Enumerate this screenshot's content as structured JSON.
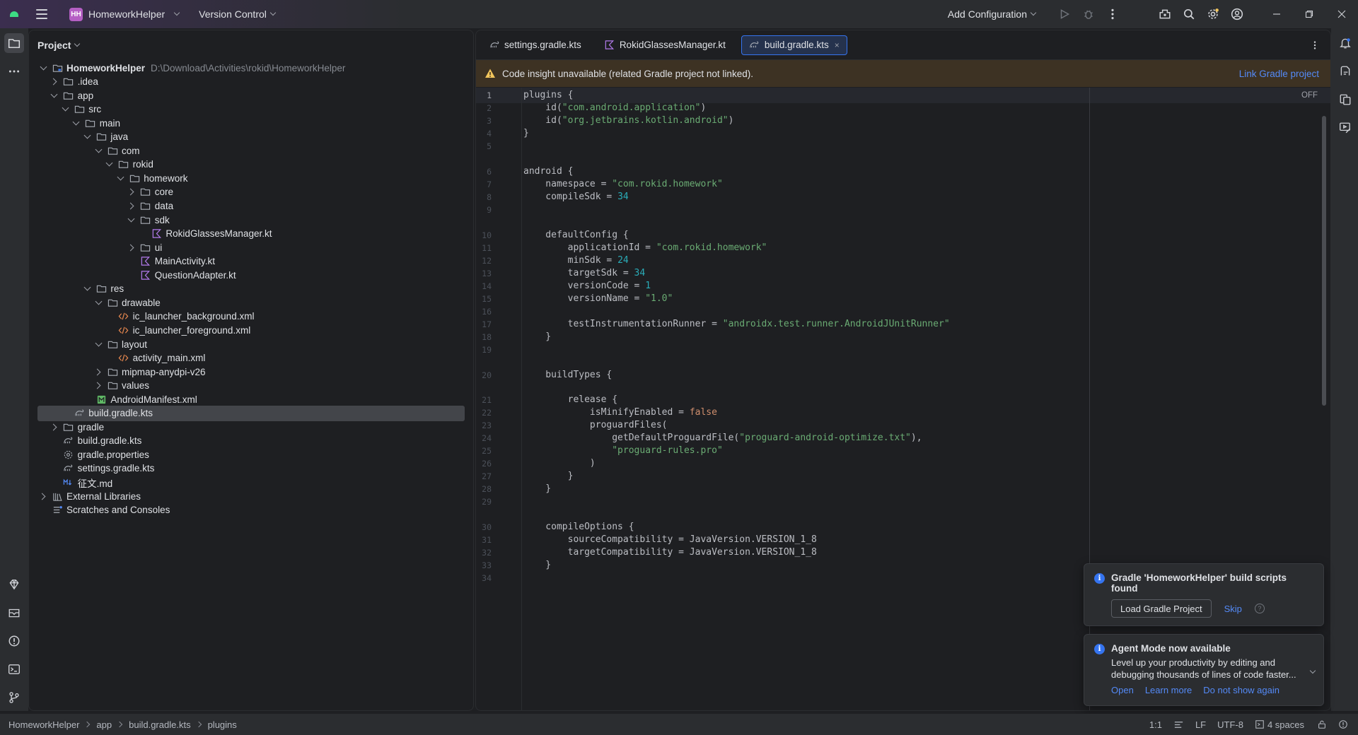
{
  "titlebar": {
    "project_initials": "HH",
    "project_name": "HomeworkHelper",
    "vcs_label": "Version Control",
    "config_label": "Add Configuration"
  },
  "project_panel": {
    "title": "Project",
    "tree": [
      {
        "label": "HomeworkHelper",
        "hint": "D:\\Download\\Activities\\rokid\\HomeworkHelper",
        "level": 0,
        "arrow": "open",
        "icon": "module-folder-icon",
        "bold": true
      },
      {
        "label": ".idea",
        "level": 1,
        "arrow": "closed",
        "icon": "folder-icon"
      },
      {
        "label": "app",
        "level": 1,
        "arrow": "open",
        "icon": "folder-icon"
      },
      {
        "label": "src",
        "level": 2,
        "arrow": "open",
        "icon": "folder-icon"
      },
      {
        "label": "main",
        "level": 3,
        "arrow": "open",
        "icon": "folder-icon"
      },
      {
        "label": "java",
        "level": 4,
        "arrow": "open",
        "icon": "folder-icon"
      },
      {
        "label": "com",
        "level": 5,
        "arrow": "open",
        "icon": "folder-icon"
      },
      {
        "label": "rokid",
        "level": 6,
        "arrow": "open",
        "icon": "folder-icon"
      },
      {
        "label": "homework",
        "level": 7,
        "arrow": "open",
        "icon": "folder-icon"
      },
      {
        "label": "core",
        "level": 8,
        "arrow": "closed",
        "icon": "folder-icon"
      },
      {
        "label": "data",
        "level": 8,
        "arrow": "closed",
        "icon": "folder-icon"
      },
      {
        "label": "sdk",
        "level": 8,
        "arrow": "open",
        "icon": "folder-icon"
      },
      {
        "label": "RokidGlassesManager.kt",
        "level": 9,
        "arrow": "none",
        "icon": "kotlin-file-icon"
      },
      {
        "label": "ui",
        "level": 8,
        "arrow": "closed",
        "icon": "folder-icon"
      },
      {
        "label": "MainActivity.kt",
        "level": 8,
        "arrow": "none",
        "icon": "kotlin-file-icon"
      },
      {
        "label": "QuestionAdapter.kt",
        "level": 8,
        "arrow": "none",
        "icon": "kotlin-file-icon"
      },
      {
        "label": "res",
        "level": 4,
        "arrow": "open",
        "icon": "folder-icon"
      },
      {
        "label": "drawable",
        "level": 5,
        "arrow": "open",
        "icon": "folder-icon"
      },
      {
        "label": "ic_launcher_background.xml",
        "level": 6,
        "arrow": "none",
        "icon": "xml-file-icon"
      },
      {
        "label": "ic_launcher_foreground.xml",
        "level": 6,
        "arrow": "none",
        "icon": "xml-file-icon"
      },
      {
        "label": "layout",
        "level": 5,
        "arrow": "open",
        "icon": "folder-icon"
      },
      {
        "label": "activity_main.xml",
        "level": 6,
        "arrow": "none",
        "icon": "xml-file-icon"
      },
      {
        "label": "mipmap-anydpi-v26",
        "level": 5,
        "arrow": "closed",
        "icon": "folder-icon"
      },
      {
        "label": "values",
        "level": 5,
        "arrow": "closed",
        "icon": "folder-icon"
      },
      {
        "label": "AndroidManifest.xml",
        "level": 4,
        "arrow": "none",
        "icon": "manifest-file-icon"
      },
      {
        "label": "build.gradle.kts",
        "level": 2,
        "arrow": "none",
        "icon": "gradle-file-icon",
        "selected": true
      },
      {
        "label": "gradle",
        "level": 1,
        "arrow": "closed",
        "icon": "folder-icon"
      },
      {
        "label": "build.gradle.kts",
        "level": 1,
        "arrow": "none",
        "icon": "gradle-file-icon"
      },
      {
        "label": "gradle.properties",
        "level": 1,
        "arrow": "none",
        "icon": "settings-file-icon"
      },
      {
        "label": "settings.gradle.kts",
        "level": 1,
        "arrow": "none",
        "icon": "gradle-file-icon"
      },
      {
        "label": "征文.md",
        "level": 1,
        "arrow": "none",
        "icon": "markdown-file-icon"
      },
      {
        "label": "External Libraries",
        "level": 0,
        "arrow": "closed",
        "icon": "library-icon"
      },
      {
        "label": "Scratches and Consoles",
        "level": 0,
        "arrow": "none",
        "icon": "scratches-icon"
      }
    ]
  },
  "editor": {
    "tabs": [
      {
        "label": "settings.gradle.kts",
        "icon": "gradle-file-icon",
        "active": false
      },
      {
        "label": "RokidGlassesManager.kt",
        "icon": "kotlin-file-icon",
        "active": false
      },
      {
        "label": "build.gradle.kts",
        "icon": "gradle-file-icon",
        "active": true,
        "close": "×"
      }
    ],
    "banner_text": "Code insight unavailable (related Gradle project not linked).",
    "banner_link": "Link Gradle project",
    "off_label": "OFF",
    "lines": [
      {
        "n": "1",
        "code": "plugins {"
      },
      {
        "n": "2",
        "code": "    id(\"com.android.application\")"
      },
      {
        "n": "3",
        "code": "    id(\"org.jetbrains.kotlin.android\")"
      },
      {
        "n": "4",
        "code": "}"
      },
      {
        "n": "5",
        "code": ""
      },
      {
        "n": "6",
        "code": "android {"
      },
      {
        "n": "7",
        "code": "    namespace = \"com.rokid.homework\""
      },
      {
        "n": "8",
        "code": "    compileSdk = 34"
      },
      {
        "n": "9",
        "code": ""
      },
      {
        "n": "10",
        "code": "    defaultConfig {"
      },
      {
        "n": "11",
        "code": "        applicationId = \"com.rokid.homework\""
      },
      {
        "n": "12",
        "code": "        minSdk = 24"
      },
      {
        "n": "13",
        "code": "        targetSdk = 34"
      },
      {
        "n": "14",
        "code": "        versionCode = 1"
      },
      {
        "n": "15",
        "code": "        versionName = \"1.0\""
      },
      {
        "n": "16",
        "code": ""
      },
      {
        "n": "17",
        "code": "        testInstrumentationRunner = \"androidx.test.runner.AndroidJUnitRunner\""
      },
      {
        "n": "18",
        "code": "    }"
      },
      {
        "n": "19",
        "code": ""
      },
      {
        "n": "20",
        "code": "    buildTypes {"
      },
      {
        "n": "21",
        "code": "        release {"
      },
      {
        "n": "22",
        "code": "            isMinifyEnabled = false"
      },
      {
        "n": "23",
        "code": "            proguardFiles("
      },
      {
        "n": "24",
        "code": "                getDefaultProguardFile(\"proguard-android-optimize.txt\"),"
      },
      {
        "n": "25",
        "code": "                \"proguard-rules.pro\""
      },
      {
        "n": "26",
        "code": "            )"
      },
      {
        "n": "27",
        "code": "        }"
      },
      {
        "n": "28",
        "code": "    }"
      },
      {
        "n": "29",
        "code": ""
      },
      {
        "n": "30",
        "code": "    compileOptions {"
      },
      {
        "n": "31",
        "code": "        sourceCompatibility = JavaVersion.VERSION_1_8"
      },
      {
        "n": "32",
        "code": "        targetCompatibility = JavaVersion.VERSION_1_8"
      },
      {
        "n": "33",
        "code": "    }"
      },
      {
        "n": "34",
        "code": ""
      }
    ]
  },
  "notifications": {
    "gradle": {
      "title": "Gradle 'HomeworkHelper' build scripts found",
      "primary_button": "Load Gradle Project",
      "skip": "Skip",
      "help": "?"
    },
    "agent": {
      "title": "Agent Mode now available",
      "body_line1": "Level up your productivity by editing and",
      "body_line2": "debugging thousands of lines of code faster...",
      "open": "Open",
      "learn_more": "Learn more",
      "dismiss": "Do not show again"
    }
  },
  "statusbar": {
    "breadcrumbs": [
      "HomeworkHelper",
      "app",
      "build.gradle.kts",
      "plugins"
    ],
    "position": "1:1",
    "line_ending": "LF",
    "encoding": "UTF-8",
    "indent": "4 spaces"
  },
  "colors": {
    "background": "#1e1f22",
    "panel": "#2b2d30",
    "accent": "#3574f0",
    "link": "#548af7",
    "warning_banner": "#3d3223"
  }
}
